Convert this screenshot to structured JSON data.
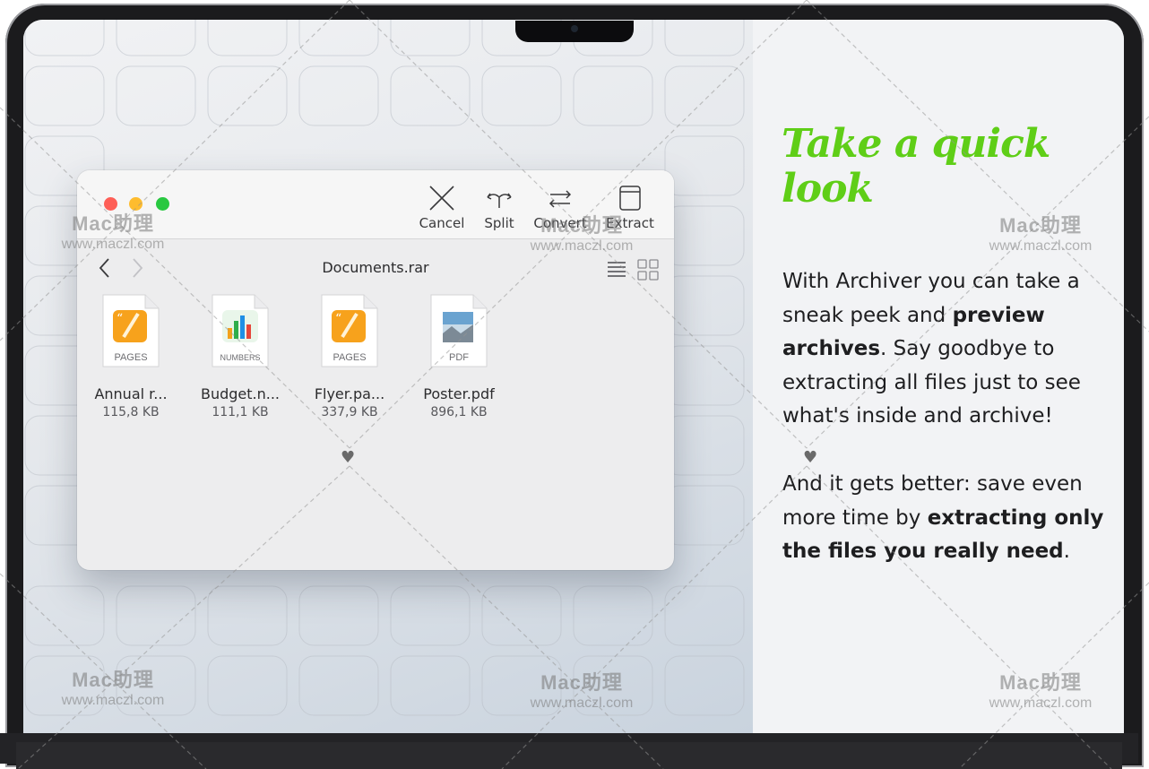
{
  "window": {
    "toolbar": {
      "cancel_label": "Cancel",
      "split_label": "Split",
      "convert_label": "Convert",
      "extract_label": "Extract"
    },
    "location_title": "Documents.rar",
    "files": [
      {
        "name": "Annual r...",
        "size": "115,8 KB",
        "type_badge": "PAGES",
        "icon": "pages-document-icon"
      },
      {
        "name": "Budget.n...",
        "size": "111,1 KB",
        "type_badge": "NUMBERS",
        "icon": "numbers-document-icon"
      },
      {
        "name": "Flyer.pa...",
        "size": "337,9 KB",
        "type_badge": "PAGES",
        "icon": "pages-document-icon"
      },
      {
        "name": "Poster.pdf",
        "size": "896,1 KB",
        "type_badge": "PDF",
        "icon": "pdf-document-icon"
      }
    ]
  },
  "promo": {
    "headline_line1": "Take a quick",
    "headline_line2": "look",
    "p1_a": "With Archiver you can take a sneak peek and ",
    "p1_b": "preview archives",
    "p1_c": ". Say goodbye to extracting all files just to see what's inside and archive!",
    "p2_a": "And it gets better: save even more time by ",
    "p2_b": "extracting only the files you really need",
    "p2_c": "."
  },
  "watermark": {
    "brand": "Mac助理",
    "url": "www.maczl.com"
  },
  "colors": {
    "headline": "#5fce17",
    "close": "#fe5f57",
    "minimize": "#febc2e",
    "zoom": "#28c840"
  }
}
